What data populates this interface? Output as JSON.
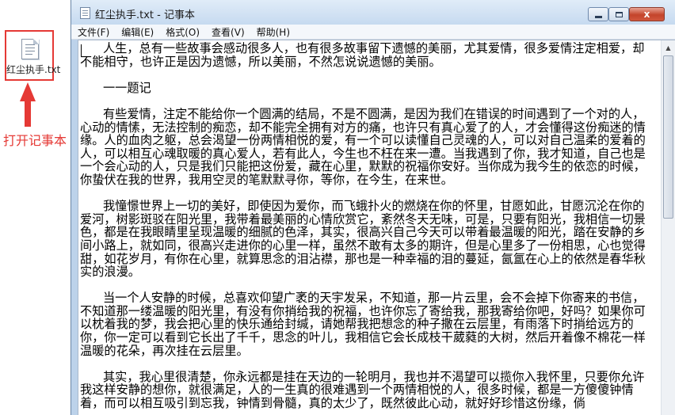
{
  "desktop": {
    "file_icon": "text-file-icon",
    "file_label": "红尘执手.txt",
    "annotation": "打开记事本",
    "highlight_color": "#e53935"
  },
  "window": {
    "title": "红尘执手.txt - 记事本",
    "close_glyph": "x",
    "menu": [
      "文件(F)",
      "编辑(E)",
      "格式(O)",
      "查看(V)",
      "帮助(H)"
    ],
    "content": "      人生，总有一些故事会感动很多人，也有很多故事留下遗憾的美丽，尤其爱情，很多爱情注定相爱，却不能相守，也许正是因为遗憾，所以美丽，不然怎说说遗憾的美丽。\n\n      一一题记\n\n      有些爱情，注定不能给你一个圆满的结局，不是不圆满，是因为我们在错误的时间遇到了一个对的人，心动的情愫，无法控制的痴恋，却不能完全拥有对方的痛，也许只有真心爱了的人，才会懂得这份痴迷的情缘。人的血肉之躯，总会渴望一份两情相悦的爱，有一个可以读懂自己灵魂的人，可以对自己温柔的爱着的人，可以相互心魂取暖的真心爱人，若有此人，今生也不枉在来一遭。当我遇到了你，我才知道，自己也是一个会心动的人，只是我们只能把这份爱，藏在心里，默默的祝福你安好。当你成为我今生的依恋的时候，你蛰伏在我的世界，我用空灵的笔默默寻你，等你，在今生，在来世。\n\n      我憧憬世界上一切的美好，即使因为爱你，而飞蛾扑火的燃烧在你的怀里，甘愿如此，甘愿沉沦在你的爱河，树影斑驳在阳光里，我带着最美丽的心情欣赏它，紊然冬天无味，可是，只要有阳光，我相信一切景色，都是在我眼睛里呈现温暖的细腻的色泽，其实，很高兴自己今天可以带着最温暖的阳光，踏在安静的乡间小路上，就如同，很高兴走进你的心里一样，虽然不敢有太多的期许，但是心里多了一份相思，心也觉得甜，如花岁月，有你在心里，就算思念的泪沾襟，那也是一种幸福的泪的蔓延，氤氲在心上的依然是春华秋实的浪漫。\n\n      当一个人安静的时候，总喜欢仰望广袤的天宇发呆，不知道，那一片云里，会不会掉下你寄来的书信，不知道那一缕温暖的阳光里，有没有你捎给我的祝福，也许你忘了寄给我，那我寄给你吧，好吗？如果你可以枕着我的梦，我会把心里的快乐通给封缄，请她帮我把想念的种子撒在云层里，有雨落下时捎给远方的你，你一定可以看到它长出了千千，思念的叶儿，我相信它会长成枝干葳蕤的大树，然后开着像不棉花一样温暖的花朵，再次挂在云层里。\n\n      其实，我心里很清楚，你永远都是挂在天边的一轮明月，我也并不渴望可以揽你入我怀里，只要你允许我这样安静的想你，就很满足，人的一生真的很难遇到一个两情相悦的人，很多时候，都是一方傻傻钟情着，而可以相互吸引到忘我，钟情到骨髓，真的太少了，既然彼此心动，就好好珍惜这份缘，倘"
  },
  "scrollbar": {
    "up_glyph": "▲"
  }
}
